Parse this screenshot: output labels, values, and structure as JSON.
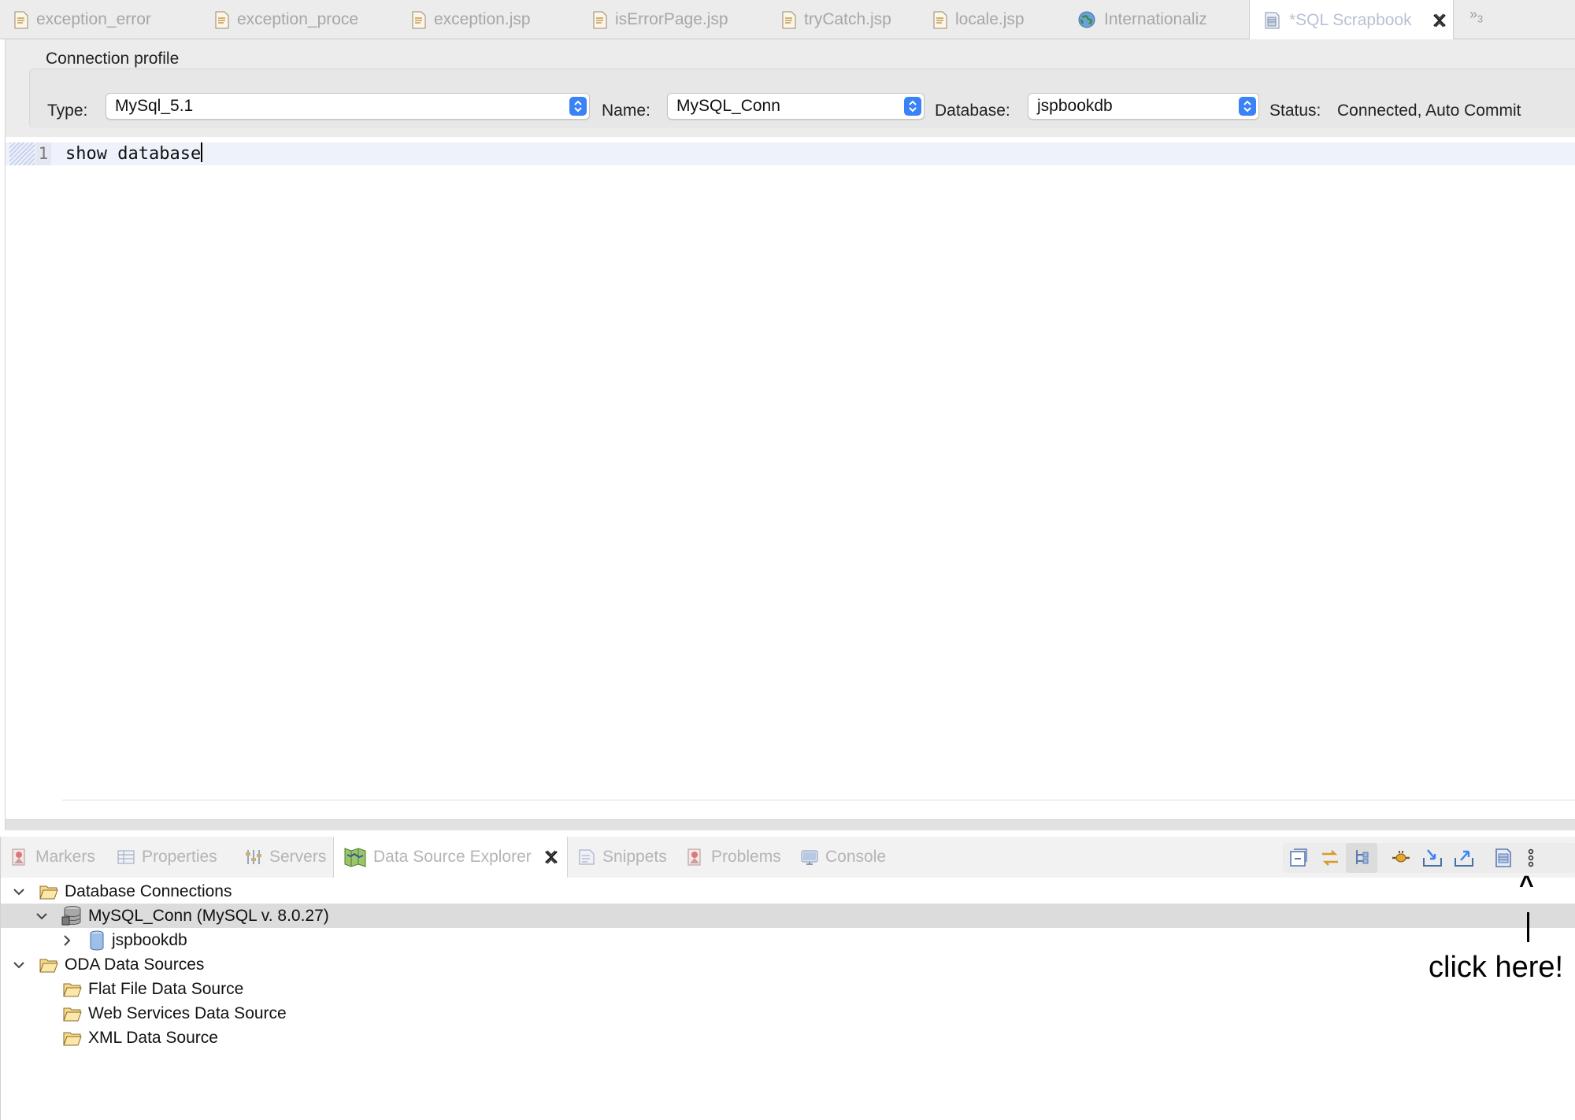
{
  "editor_tabs": [
    {
      "label": "exception_error",
      "icon": "jsp-file-icon"
    },
    {
      "label": "exception_proce",
      "icon": "jsp-file-icon"
    },
    {
      "label": "exception.jsp",
      "icon": "jsp-file-icon"
    },
    {
      "label": "isErrorPage.jsp",
      "icon": "jsp-file-icon"
    },
    {
      "label": "tryCatch.jsp",
      "icon": "jsp-file-icon"
    },
    {
      "label": "locale.jsp",
      "icon": "jsp-file-icon"
    },
    {
      "label": "Internationaliz",
      "icon": "globe-icon"
    },
    {
      "label": "*SQL Scrapbook",
      "icon": "sql-scrapbook-icon",
      "active": true
    }
  ],
  "overflow_tabs": {
    "chevrons": "»",
    "count": "3"
  },
  "connection_profile": {
    "title": "Connection profile",
    "type_label": "Type:",
    "type_value": "MySql_5.1",
    "name_label": "Name:",
    "name_value": "MySQL_Conn",
    "database_label": "Database:",
    "database_value": "jspbookdb",
    "status_label": "Status:",
    "status_value": "Connected, Auto Commit"
  },
  "editor": {
    "line_number": "1",
    "code": "show database"
  },
  "view_tabs": [
    {
      "label": "Markers",
      "icon": "markers-icon"
    },
    {
      "label": "Properties",
      "icon": "properties-icon"
    },
    {
      "label": "Servers",
      "icon": "servers-icon"
    },
    {
      "label": "Data Source Explorer",
      "icon": "data-source-explorer-icon",
      "active": true
    },
    {
      "label": "Snippets",
      "icon": "snippets-icon"
    },
    {
      "label": "Problems",
      "icon": "problems-icon"
    },
    {
      "label": "Console",
      "icon": "console-icon"
    }
  ],
  "tree": [
    {
      "label": "Database Connections",
      "expanded": true,
      "icon": "folder-open-icon"
    },
    {
      "label": "MySQL_Conn (MySQL v. 8.0.27)",
      "expanded": true,
      "icon": "database-server-icon",
      "selected": true
    },
    {
      "label": "jspbookdb",
      "expanded": false,
      "icon": "database-icon"
    },
    {
      "label": "ODA Data Sources",
      "expanded": true,
      "icon": "folder-open-icon"
    },
    {
      "label": "Flat File Data Source",
      "icon": "folder-open-icon"
    },
    {
      "label": "Web Services Data Source",
      "icon": "folder-open-icon"
    },
    {
      "label": "XML Data Source",
      "icon": "folder-open-icon"
    }
  ],
  "annotation": {
    "arrow": "^",
    "text": "click here!"
  },
  "colors": {
    "accent_blue": "#3a82f6",
    "tab_bar_bg": "#ececec",
    "selection_bg": "#dcdcdc",
    "current_line_bg": "#eef2fb"
  }
}
